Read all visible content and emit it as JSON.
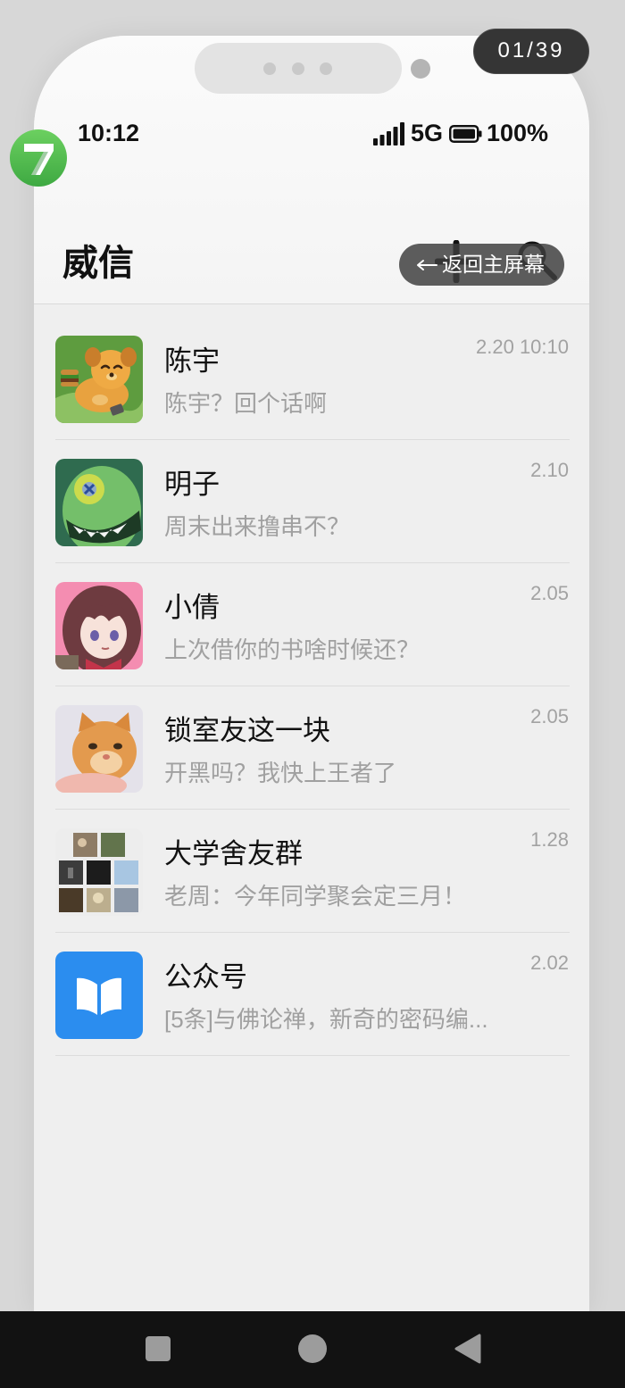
{
  "page_counter": "01/39",
  "status_bar": {
    "time": "10:12",
    "network": "5G",
    "battery": "100%",
    "icons": [
      "signal-icon",
      "battery-icon"
    ]
  },
  "header": {
    "title": "威信",
    "back_home_label": "返回主屏幕",
    "icons": [
      "plus-icon",
      "search-icon",
      "arrow-left-icon"
    ]
  },
  "chats": [
    {
      "name": "陈宇",
      "preview": "陈宇？回个话啊",
      "time": "2.20 10:10"
    },
    {
      "name": "明子",
      "preview": "周末出来撸串不？",
      "time": "2.10"
    },
    {
      "name": "小倩",
      "preview": "上次借你的书啥时候还？",
      "time": "2.05"
    },
    {
      "name": "锁室友这一块",
      "preview": "开黑吗？我快上王者了",
      "time": "2.05"
    },
    {
      "name": "大学舍友群",
      "preview": "老周：今年同学聚会定三月！",
      "time": "1.28"
    },
    {
      "name": "公众号",
      "preview": "[5条]与佛论禅，新奇的密码编...",
      "time": "2.02"
    }
  ],
  "nav_bar": {
    "icons": [
      "recent-apps-icon",
      "home-icon",
      "back-icon"
    ]
  },
  "colors": {
    "public_account_blue": "#2b8def",
    "logo_green": "#4db84a",
    "nav_bar": "#121212",
    "preview_text": "#a0a0a0"
  }
}
